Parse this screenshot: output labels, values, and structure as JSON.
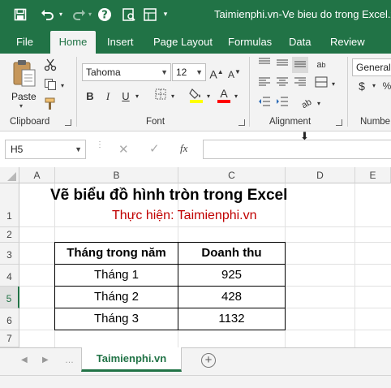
{
  "window": {
    "title": "Taimienphi.vn-Ve bieu do trong Excel.xls"
  },
  "quick_access": {
    "save_icon": "save-icon",
    "undo_icon": "undo-icon",
    "redo_icon": "redo-icon",
    "help_icon": "help-icon",
    "print_preview_icon": "print-preview-icon"
  },
  "tabs": [
    "File",
    "Home",
    "Insert",
    "Page Layout",
    "Formulas",
    "Data",
    "Review"
  ],
  "active_tab": "Home",
  "ribbon": {
    "clipboard": {
      "label": "Clipboard",
      "paste_label": "Paste"
    },
    "font": {
      "label": "Font",
      "font_name": "Tahoma",
      "font_size": "12",
      "bold": "B",
      "italic": "I",
      "underline": "U"
    },
    "alignment": {
      "label": "Alignment"
    },
    "number": {
      "label": "Numbe",
      "format": "General",
      "currency": "$"
    }
  },
  "formula_bar": {
    "name_box": "H5",
    "fx": "fx",
    "formula": ""
  },
  "sheet": {
    "columns": [
      "A",
      "B",
      "C",
      "D",
      "E"
    ],
    "rows": [
      "1",
      "2",
      "3",
      "4",
      "5",
      "6",
      "7"
    ],
    "title": "Vẽ biểu đồ hình tròn trong Excel",
    "subtitle": "Thực hiện: Taimienphi.vn",
    "table_headers": [
      "Tháng trong năm",
      "Doanh thu"
    ],
    "table_rows": [
      [
        "Tháng 1",
        "925"
      ],
      [
        "Tháng 2",
        "428"
      ],
      [
        "Tháng 3",
        "1132"
      ]
    ]
  },
  "sheet_tabs": {
    "active": "Taimienphi.vn"
  },
  "colors": {
    "excel_green": "#217346",
    "subtitle_red": "#c00000",
    "fill_yellow": "#ffff00",
    "font_red": "#ff0000"
  }
}
